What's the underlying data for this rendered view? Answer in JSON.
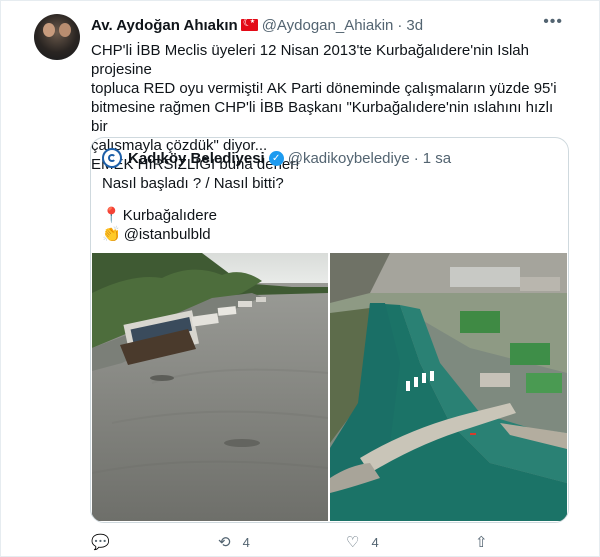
{
  "author": {
    "name": "Av. Aydoğan Ahıakın",
    "handle": "@Aydogan_Ahiakin",
    "separator": "·",
    "time": "3d"
  },
  "tweet_lines": [
    "CHP'li İBB Meclis üyeleri 12 Nisan 2013'te Kurbağalıdere'nin Islah projesine",
    "topluca RED oyu vermişti! AK Parti döneminde çalışmaların yüzde 95'i",
    "bitmesine rağmen CHP'li İBB Başkanı \"Kurbağalıdere'nin ıslahını hızlı bir",
    "çalışmayla çözdük\" diyor...",
    "EMEK HIRSIZLIĞI buna derler!"
  ],
  "more_icon": "more-horizontal-icon",
  "quoted": {
    "name": "Kadıköy Belediyesi",
    "handle": "@kadikoybelediye",
    "separator": "·",
    "time": "1 sa",
    "line1": "Nasıl başladı ? / Nasıl bitti?",
    "line2": "Kurbağalıdere",
    "line3": "@istanbulbld",
    "line2_icon": "pin-icon",
    "line3_icon": "clapping-hands-icon"
  },
  "actions": {
    "reply_count": "",
    "retweet_count": "4",
    "like_count": "4",
    "reply_icon": "reply-icon",
    "retweet_icon": "retweet-icon",
    "like_icon": "heart-icon",
    "share_icon": "share-icon"
  },
  "colors": {
    "secondary_text": "#536471",
    "verified": "#1d9bf0",
    "border": "#cfd9de",
    "flag_red": "#e30a17"
  }
}
